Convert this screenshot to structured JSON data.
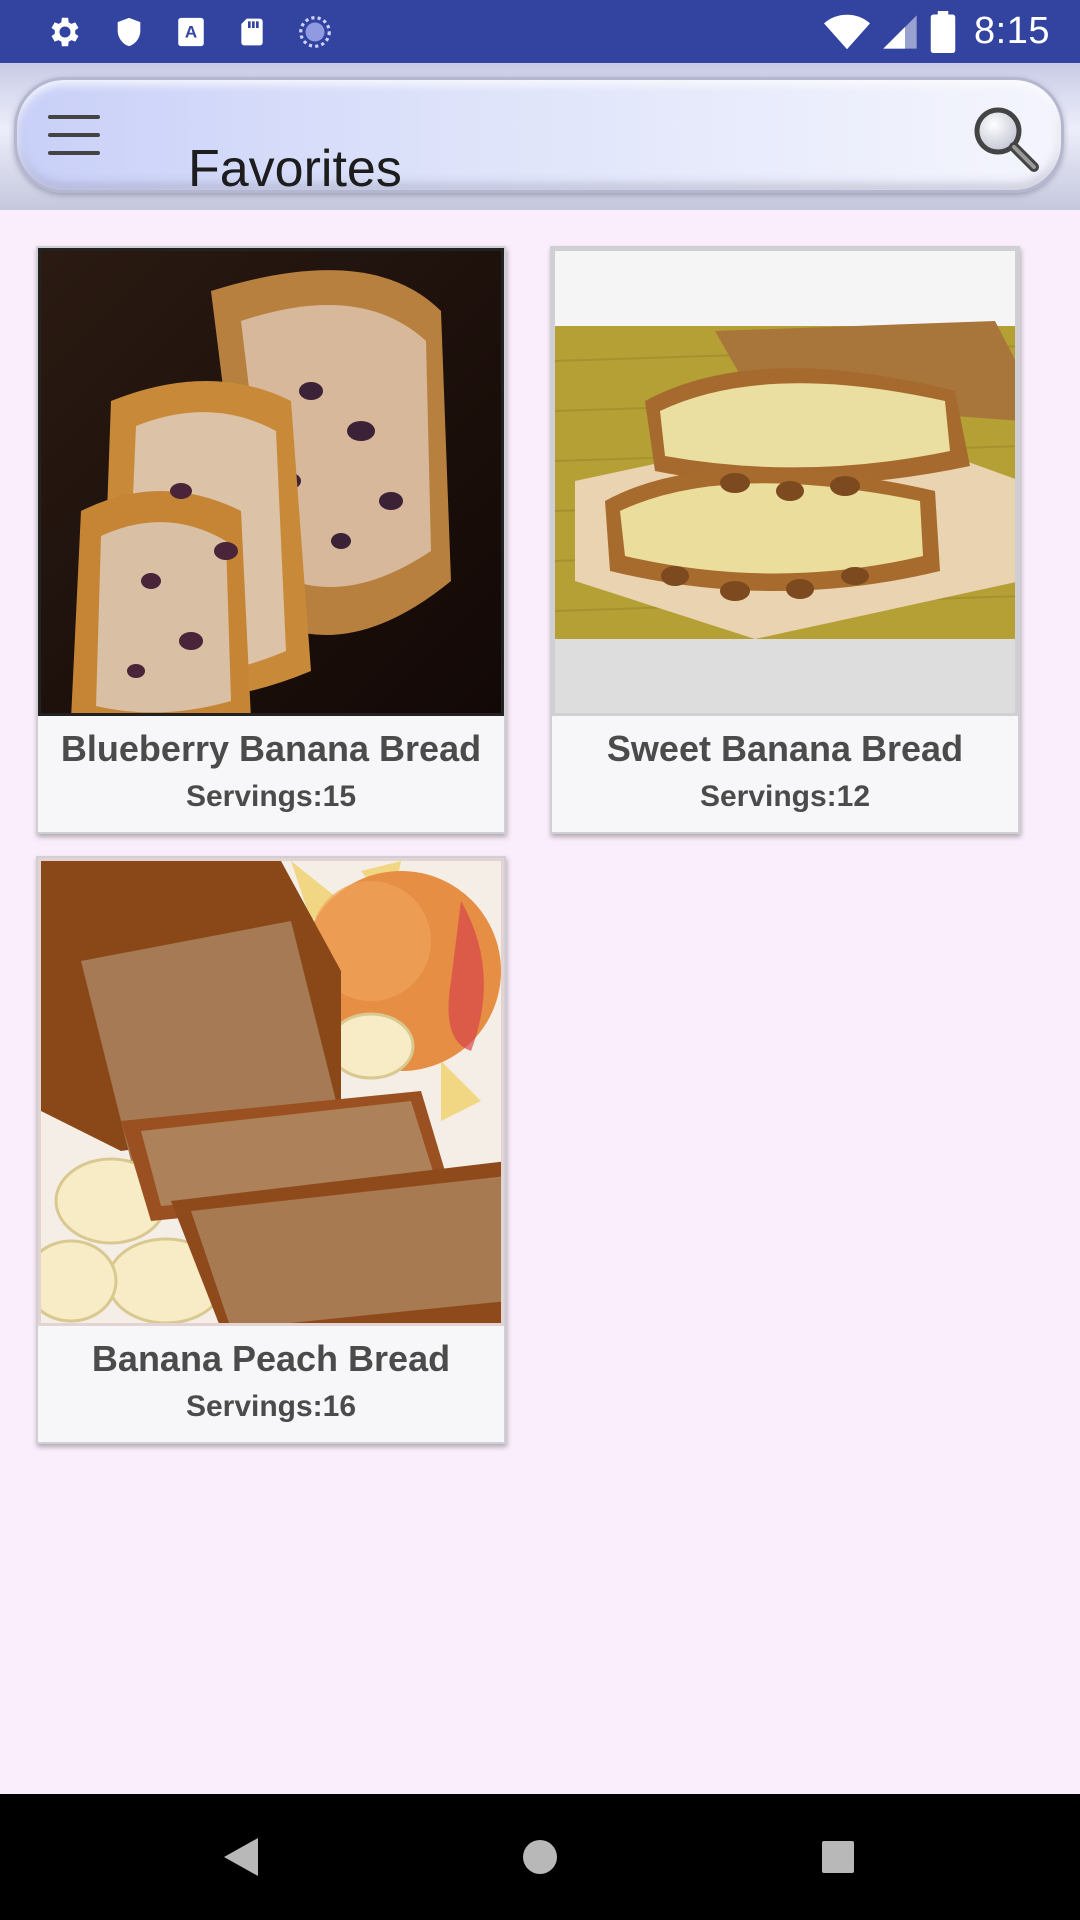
{
  "status_bar": {
    "time": "8:15",
    "icons": [
      "gear-icon",
      "shield-icon",
      "font-a-icon",
      "sd-card-icon",
      "sync-circle-icon",
      "wifi-icon",
      "signal-icon",
      "battery-icon"
    ]
  },
  "toolbar": {
    "title": "Favorites",
    "menu_icon": "hamburger-menu-icon",
    "search_icon": "search-icon"
  },
  "recipes": [
    {
      "title": "Blueberry Banana Bread",
      "servings": "Servings:15"
    },
    {
      "title": "Sweet Banana Bread",
      "servings": "Servings:12"
    },
    {
      "title": "Banana Peach Bread",
      "servings": "Servings:16"
    }
  ],
  "nav_bar": {
    "icons": [
      "back-icon",
      "home-icon",
      "recents-icon"
    ]
  },
  "colors": {
    "status_bar": "#3243a0",
    "background": "#fbeefc",
    "nav_bar": "#000000"
  }
}
